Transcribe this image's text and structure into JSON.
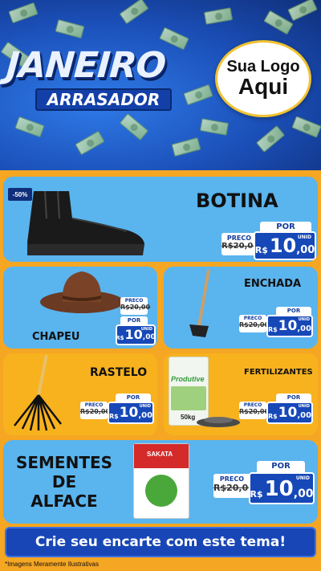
{
  "header": {
    "title_line1": "JANEIRO",
    "title_line2": "ARRASADOR",
    "logo_line1": "Sua Logo",
    "logo_line2": "Aqui"
  },
  "products": [
    {
      "name": "BOTINA",
      "badge": "-50%",
      "preco_label": "PRECO",
      "old_price": "R$20,00",
      "por_label": "POR",
      "currency": "R$",
      "price_int": "10",
      "price_cents": ",00",
      "unit": "UNID"
    },
    {
      "name": "CHAPEU",
      "preco_label": "PRECO",
      "old_price": "R$20,00",
      "por_label": "POR",
      "currency": "R$",
      "price_int": "10",
      "price_cents": ",00",
      "unit": "UNID"
    },
    {
      "name": "ENCHADA",
      "preco_label": "PRECO",
      "old_price": "R$20,00",
      "por_label": "POR",
      "currency": "R$",
      "price_int": "10",
      "price_cents": ",00",
      "unit": "UNID"
    },
    {
      "name": "RASTELO",
      "preco_label": "PRECO",
      "old_price": "R$20,00",
      "por_label": "POR",
      "currency": "R$",
      "price_int": "10",
      "price_cents": ",00",
      "unit": "UNID"
    },
    {
      "name": "FERTILIZANTES",
      "bag_brand": "Produtive",
      "bag_weight": "50kg",
      "preco_label": "PRECO",
      "old_price": "R$20,00",
      "por_label": "POR",
      "currency": "R$",
      "price_int": "10",
      "price_cents": ",00",
      "unit": "UNID"
    },
    {
      "name_line1": "SEMENTES",
      "name_line2": "DE",
      "name_line3": "ALFACE",
      "pack_brand": "SAKATA",
      "preco_label": "PRECO",
      "old_price": "R$20,00",
      "por_label": "POR",
      "currency": "R$",
      "price_int": "10",
      "price_cents": ",00",
      "unit": "UNID"
    }
  ],
  "footer": {
    "cta": "Crie seu encarte com este tema!",
    "disclaimer": "*Imagens Meramente Ilustrativas"
  },
  "colors": {
    "header_blue": "#1b4fb8",
    "panel_blue": "#5ab4ee",
    "panel_yellow": "#f7b21e",
    "price_blue": "#1648b8",
    "background_orange": "#f5a623"
  }
}
